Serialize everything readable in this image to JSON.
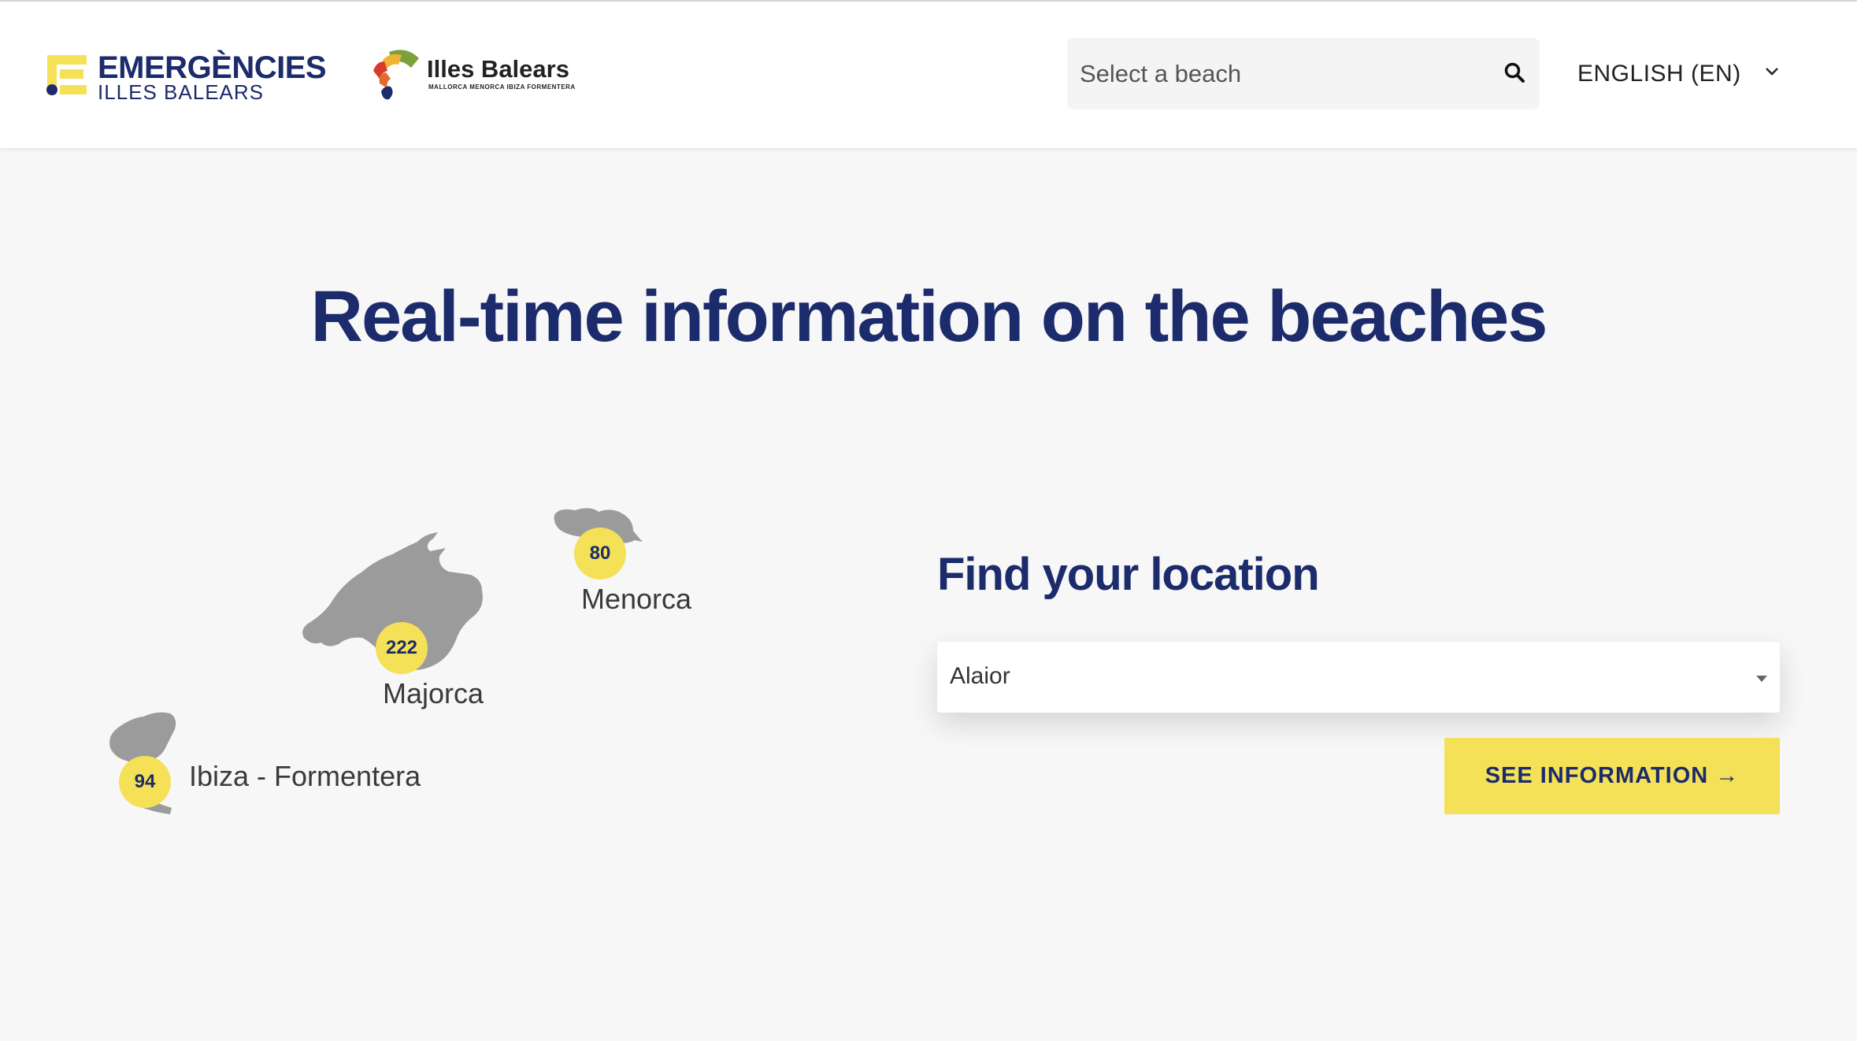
{
  "header": {
    "logo_emergencies": {
      "line1": "EMERGÈNCIES",
      "line2": "ILLES BALEARS"
    },
    "logo_illes_balears": {
      "title": "Illes Balears",
      "subtitle": "MALLORCA  MENORCA  IBIZA  FORMENTERA"
    },
    "search": {
      "placeholder": "Select a beach",
      "icon": "search-icon"
    },
    "language": {
      "label": "ENGLISH (EN)",
      "icon": "chevron-down-icon"
    }
  },
  "hero": {
    "title": "Real-time information on the beaches"
  },
  "map": {
    "islands": [
      {
        "name": "Menorca",
        "count": "80"
      },
      {
        "name": "Majorca",
        "count": "222"
      },
      {
        "name": "Ibiza - Formentera",
        "count": "94"
      }
    ]
  },
  "locator": {
    "title": "Find your location",
    "selected": "Alaior",
    "button_label": "SEE INFORMATION →"
  },
  "colors": {
    "navy": "#1c2b6b",
    "yellow": "#f4e157",
    "island_gray": "#9b9b9b",
    "background": "#f7f7f7"
  }
}
